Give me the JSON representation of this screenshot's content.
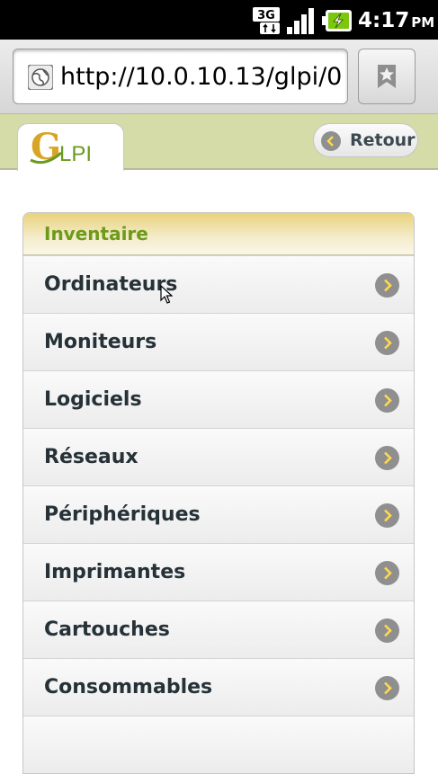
{
  "status_bar": {
    "network_label": "3G",
    "time": "4:17",
    "ampm": "PM"
  },
  "browser": {
    "url": "http://10.0.10.13/glpi/0...."
  },
  "header": {
    "logo_g": "G",
    "logo_text": "LPI",
    "back_label": "Retour"
  },
  "inventory": {
    "title": "Inventaire",
    "items": [
      {
        "label": "Ordinateurs"
      },
      {
        "label": "Moniteurs"
      },
      {
        "label": "Logiciels"
      },
      {
        "label": "Réseaux"
      },
      {
        "label": "Périphériques"
      },
      {
        "label": "Imprimantes"
      },
      {
        "label": "Cartouches"
      },
      {
        "label": "Consommables"
      }
    ]
  },
  "colors": {
    "header_bg": "#d5dca7",
    "section_title": "#6c9a1a",
    "chevron": "#8f8f8f"
  }
}
